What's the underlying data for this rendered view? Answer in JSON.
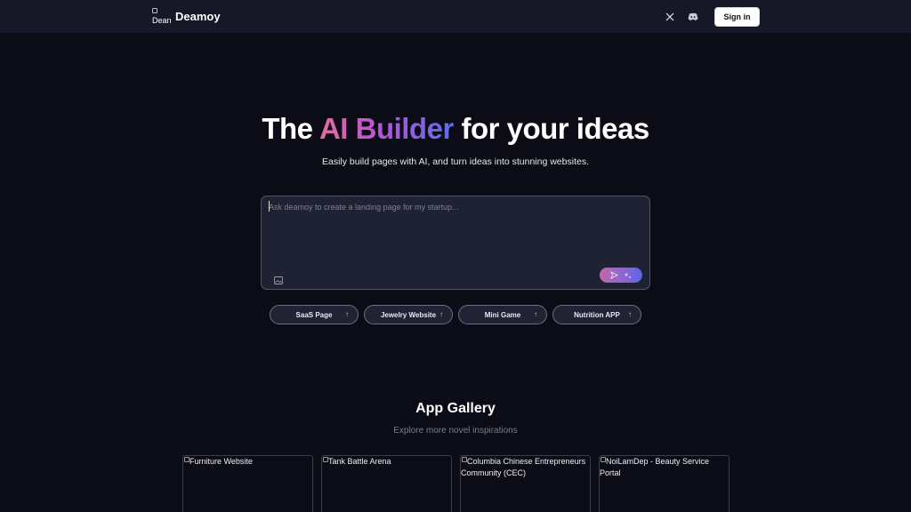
{
  "header": {
    "logo_alt": "Dearr",
    "brand": "Deamoy",
    "icons": [
      "x-twitter-icon",
      "discord-icon"
    ],
    "signin_label": "Sign in"
  },
  "hero": {
    "title_before": "The ",
    "title_highlight": "AI Builder",
    "title_after": " for your ideas",
    "subtitle": "Easily build pages with AI, and turn ideas into stunning websites."
  },
  "prompt": {
    "placeholder": "Ask deamoy to create a landing page for my startup...",
    "value": ""
  },
  "chips": [
    {
      "label": "SaaS Page"
    },
    {
      "label": "Jewelry Website"
    },
    {
      "label": "Mini Game"
    },
    {
      "label": "Nutrition APP"
    }
  ],
  "gallery": {
    "title": "App Gallery",
    "subtitle": "Explore more novel inspirations",
    "cards": [
      {
        "alt": "Furniture Website"
      },
      {
        "alt": "Tank Battle Arena"
      },
      {
        "alt": "Columbia Chinese Entrepreneurs Community (CEC)"
      },
      {
        "alt": "NoiLamDep - Beauty Service Portal"
      }
    ]
  },
  "colors": {
    "background": "#0b0c16",
    "header": "#161827",
    "gradient_start": "#e86b9f",
    "gradient_end": "#5a6df0"
  }
}
